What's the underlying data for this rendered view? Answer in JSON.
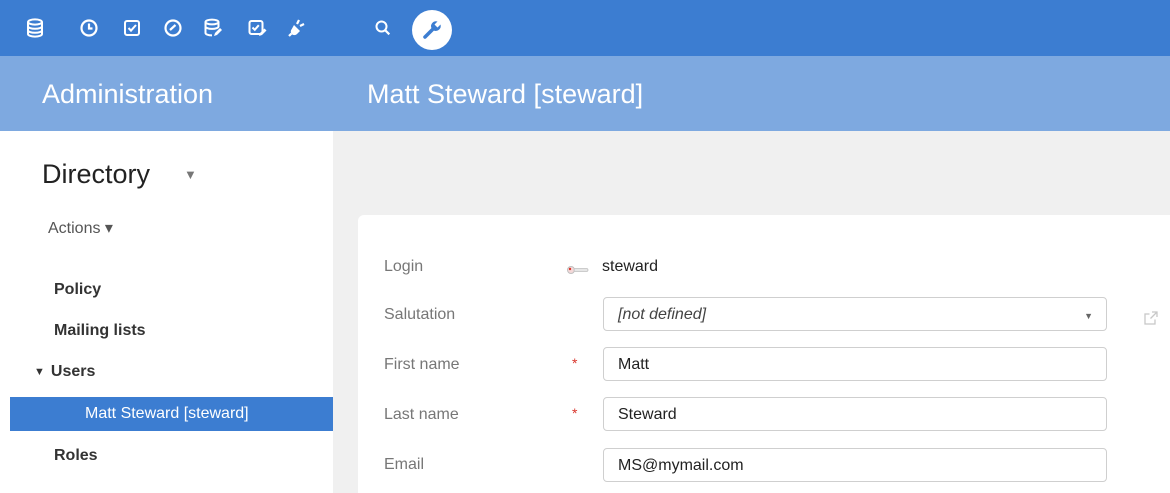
{
  "toolbar": {
    "icons": [
      "database-icon",
      "clock-icon",
      "checkbox-icon",
      "gauge-icon",
      "database-edit-icon",
      "checkbox-edit-icon",
      "plug-icon",
      "search-icon",
      "wrench-icon"
    ],
    "active_icon": "wrench-icon",
    "colors": {
      "bar": "#3c7dd1",
      "header": "#7ea9e0",
      "selected": "#3c7dd1",
      "required": "#d9342b"
    }
  },
  "header": {
    "section": "Administration",
    "title": "Matt Steward [steward]"
  },
  "sidebar": {
    "directory_label": "Directory",
    "actions_label": "Actions ▾",
    "items": [
      {
        "label": "Policy"
      },
      {
        "label": "Mailing lists"
      },
      {
        "label": "Users"
      },
      {
        "label": "Matt Steward [steward]"
      },
      {
        "label": "Roles"
      }
    ],
    "selected_item": "Matt Steward [steward]"
  },
  "form": {
    "login": {
      "label": "Login",
      "value": "steward"
    },
    "salutation": {
      "label": "Salutation",
      "value": "[not defined]"
    },
    "first_name": {
      "label": "First name",
      "value": "Matt",
      "required_mark": "*"
    },
    "last_name": {
      "label": "Last name",
      "value": "Steward",
      "required_mark": "*"
    },
    "email": {
      "label": "Email",
      "value": "MS@mymail.com"
    }
  }
}
